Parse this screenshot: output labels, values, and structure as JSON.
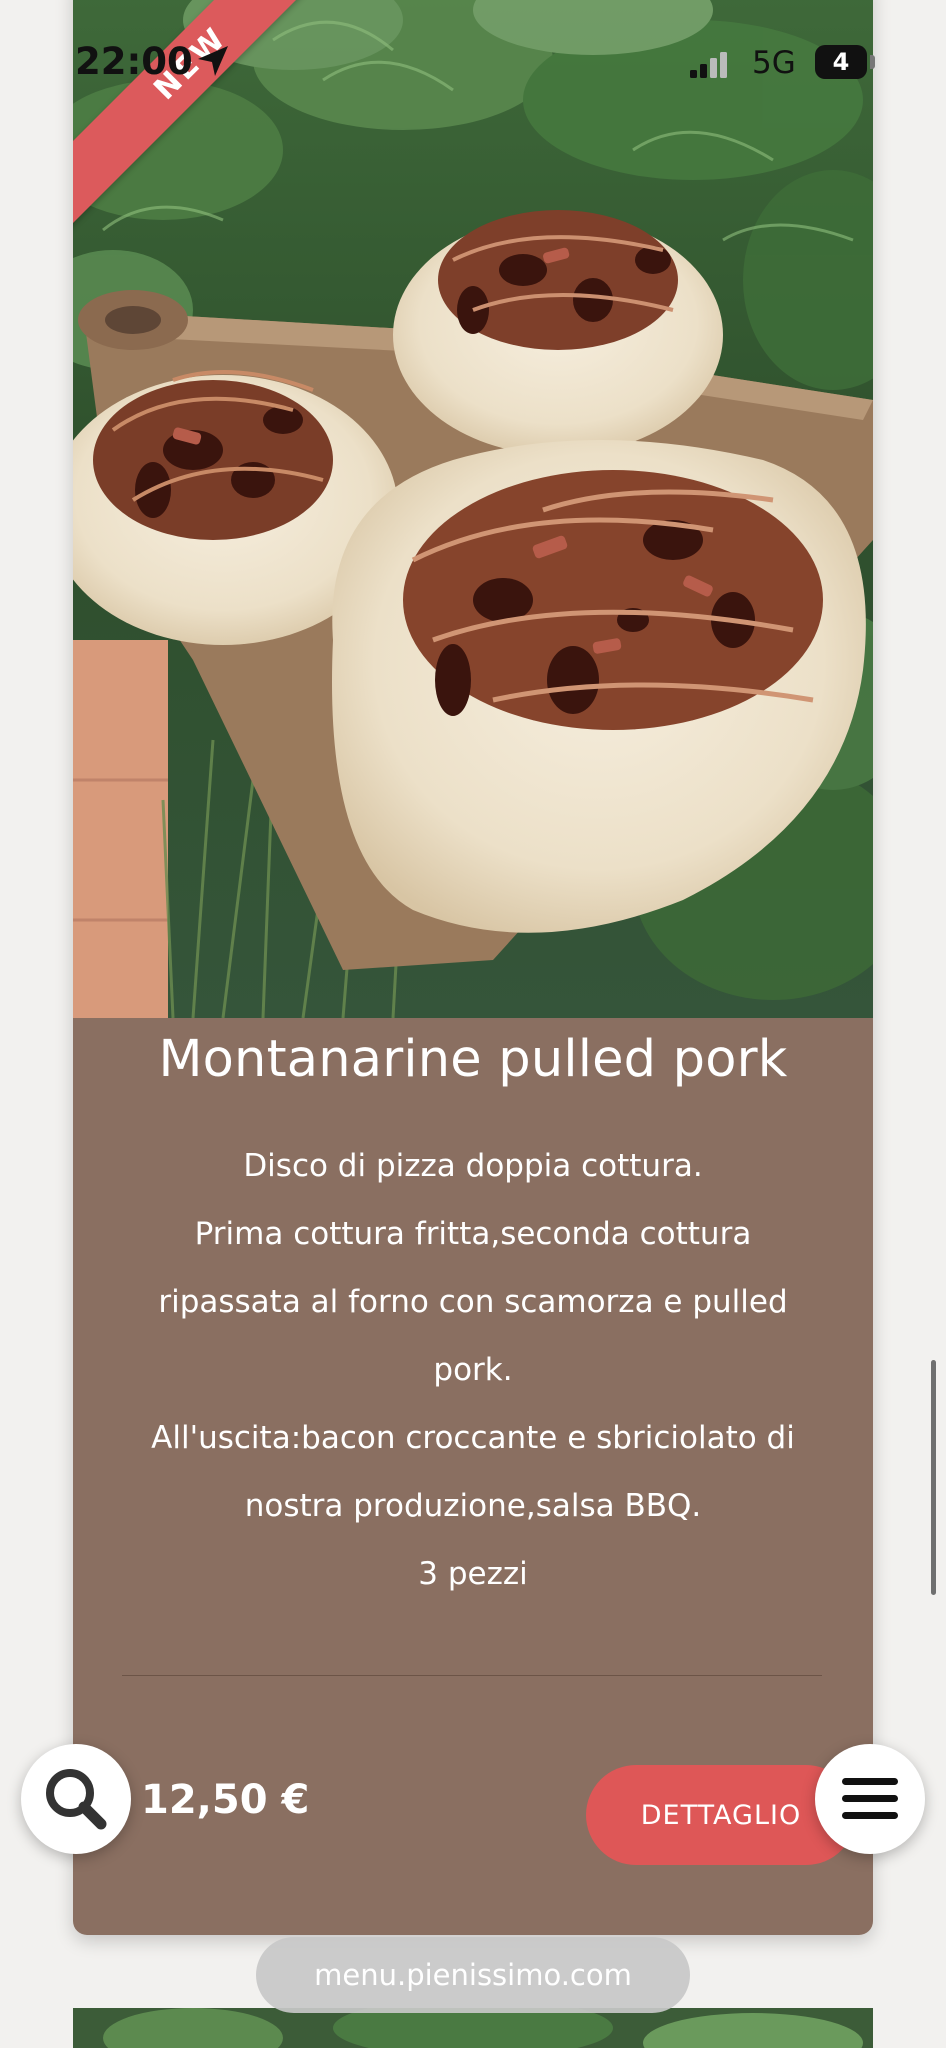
{
  "status_bar": {
    "time": "22:00",
    "network": "5G",
    "battery": "4"
  },
  "product": {
    "badge": "NEW",
    "title": "Montanarine pulled pork",
    "description_lines": [
      "Disco di pizza doppia cottura.",
      "Prima cottura fritta,seconda cottura",
      "ripassata al forno con scamorza e pulled",
      "pork.",
      "All'uscita:bacon croccante e sbriciolato di",
      "nostra produzione,salsa BBQ.",
      "3 pezzi"
    ],
    "price": "12,50 €",
    "detail_label": "DETTAGLIO"
  },
  "browser": {
    "url": "menu.pienissimo.com"
  },
  "icons": {
    "location": "location-arrow-icon",
    "signal": "signal-icon",
    "search": "search-icon",
    "menu": "hamburger-menu-icon"
  },
  "colors": {
    "card_background": "#8a6f61",
    "accent": "#de5757",
    "page_background": "#f2f1ef"
  }
}
